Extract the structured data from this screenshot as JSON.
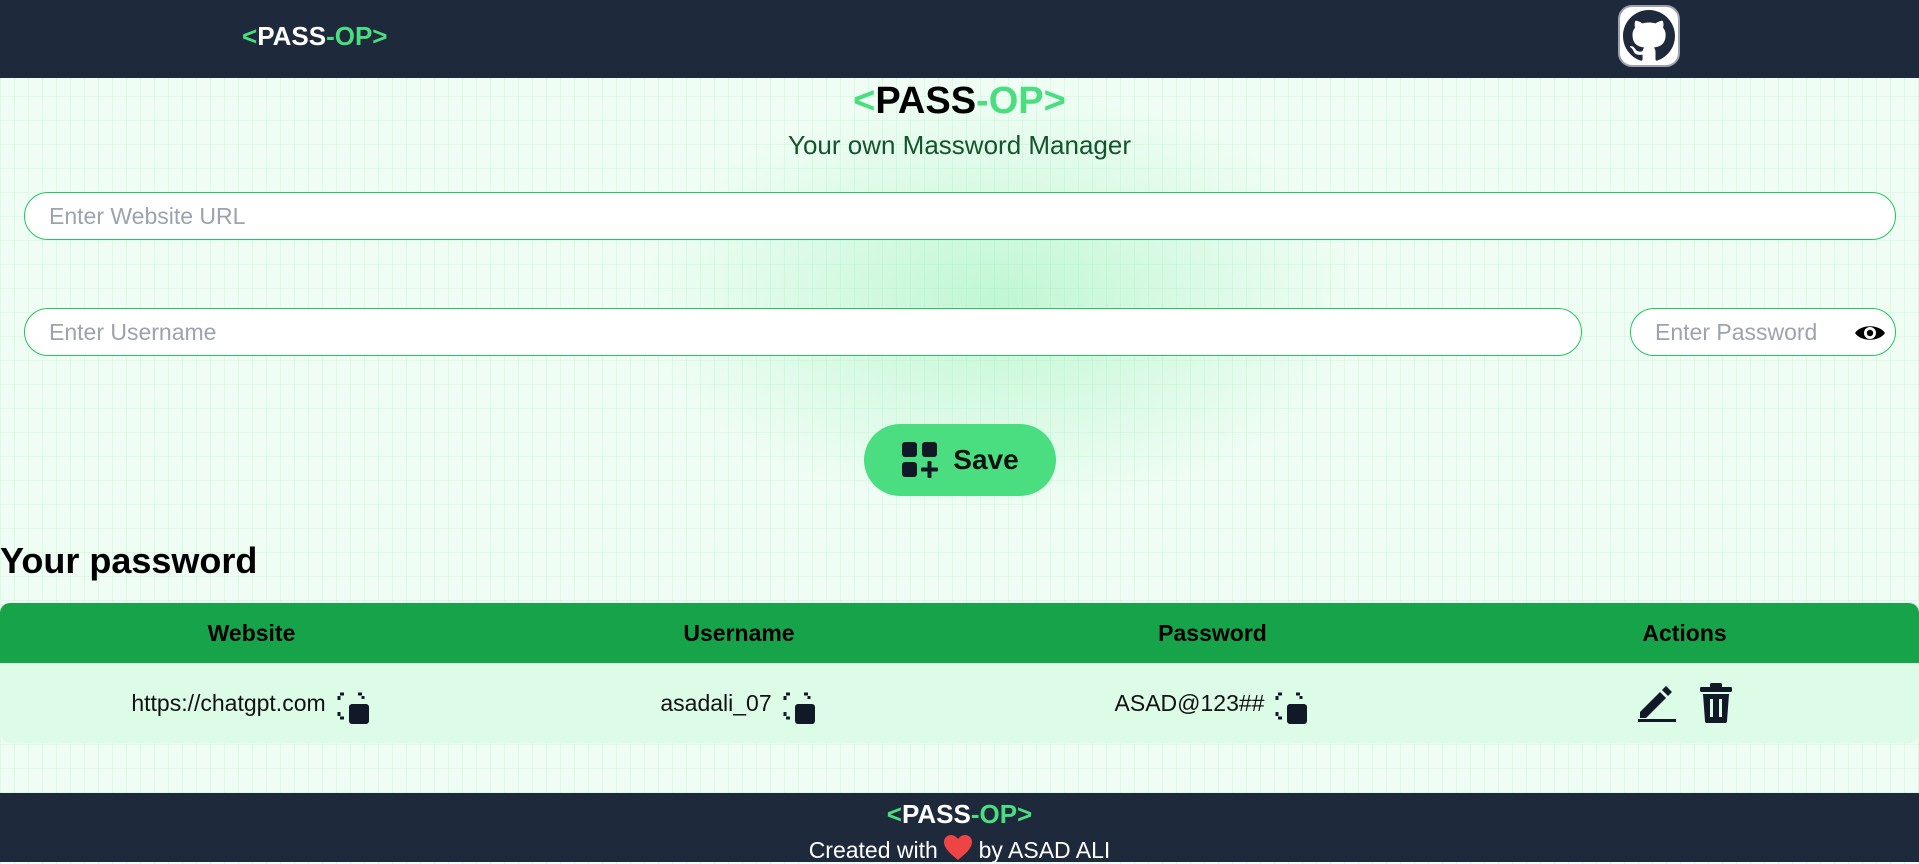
{
  "brand": {
    "lt": "<",
    "pass": "PASS",
    "dash_op": "-OP",
    "gt": ">"
  },
  "navbar": {
    "github_icon": "github-icon"
  },
  "hero": {
    "subtitle": "Your own Massword Manager"
  },
  "form": {
    "website_placeholder": "Enter Website URL",
    "website_value": "",
    "username_placeholder": "Enter Username",
    "username_value": "",
    "password_placeholder": "Enter Password",
    "password_value": "",
    "save_label": "Save"
  },
  "passwords": {
    "title": "Your password",
    "headers": [
      "Website",
      "Username",
      "Password",
      "Actions"
    ],
    "rows": [
      {
        "site": "https://chatgpt.com",
        "username": "asadali_07",
        "password": "ASAD@123##"
      }
    ]
  },
  "footer": {
    "created_with": "Created with",
    "by": "by ASAD ALI"
  },
  "colors": {
    "accent": "#4ade80",
    "dark": "#1e293b",
    "table_header": "#16a34a",
    "row_bg": "#dcfce7",
    "heart": "#ef4444"
  }
}
